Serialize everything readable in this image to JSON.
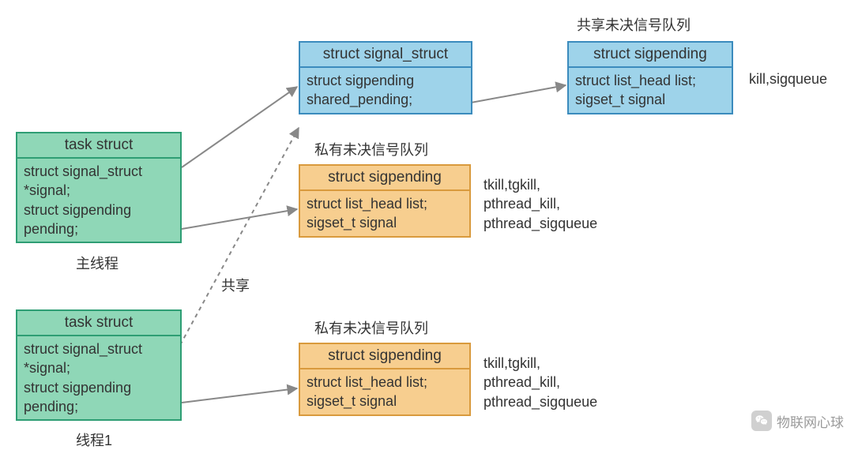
{
  "boxes": {
    "task1": {
      "title": "task struct",
      "body": "struct signal_struct\n*signal;\nstruct sigpending\npending;"
    },
    "task2": {
      "title": "task struct",
      "body": "struct signal_struct\n*signal;\nstruct sigpending\npending;"
    },
    "signal_struct": {
      "title": "struct signal_struct",
      "body": "struct sigpending\nshared_pending;"
    },
    "shared_sigpending": {
      "title": "struct sigpending",
      "body": "struct list_head list;\nsigset_t signal"
    },
    "private_sigpending1": {
      "title": "struct sigpending",
      "body": "struct list_head list;\nsigset_t signal"
    },
    "private_sigpending2": {
      "title": "struct sigpending",
      "body": "struct list_head list;\nsigset_t signal"
    }
  },
  "labels": {
    "shared_queue_title": "共享未决信号队列",
    "private_queue_title1": "私有未决信号队列",
    "private_queue_title2": "私有未决信号队列",
    "main_thread": "主线程",
    "thread1": "线程1",
    "shared_arrow": "共享",
    "shared_api": "kill,sigqueue",
    "private_api1": "tkill,tgkill,\npthread_kill,\npthread_sigqueue",
    "private_api2": "tkill,tgkill,\npthread_kill,\npthread_sigqueue",
    "watermark": "物联网心球"
  }
}
